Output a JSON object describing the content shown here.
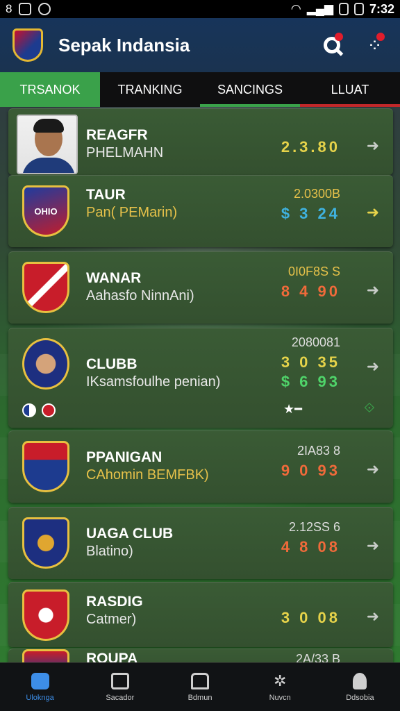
{
  "status_bar": {
    "time": "7:32",
    "left_icons": [
      "8",
      "S",
      "G"
    ]
  },
  "app": {
    "title": "Sepak Indansia"
  },
  "tabs": [
    {
      "label": "TRSANOK",
      "active": true
    },
    {
      "label": "TRANKING",
      "active": false
    },
    {
      "label": "SANCINGS",
      "active": false
    },
    {
      "label": "LLUAT",
      "active": false
    }
  ],
  "entries": [
    {
      "name": "REAGFR",
      "sub": "PHELMAHN",
      "rank": "",
      "score": "2.3.80",
      "score_colors": [
        "#e6d34a"
      ]
    },
    {
      "name": "TAUR",
      "sub": "Pan( PEMarin)",
      "rank": "2.0300B",
      "score": "$ 3 24",
      "score_colors": [
        "#34c77a",
        "#e6d34a",
        "#3fb2e0"
      ]
    },
    {
      "name": "WANAR",
      "sub": "Aahasfo NinnAni)",
      "rank": "0I0F8S S",
      "score": "8 4 90",
      "score_colors": [
        "#f06a3a",
        "#e6d34a",
        "#3fb2e0"
      ]
    },
    {
      "name": "CLUBB",
      "sub": "IKsamsfoulhe penian)",
      "rank": "2080081",
      "score": "3 0 35",
      "score2": "$ 6 93",
      "score_colors": [
        "#e6d34a",
        "#4fd46a",
        "#3fb2e0"
      ],
      "footer_icons": [
        "flag-icon",
        "flag-icon",
        "star-icon",
        "link-icon"
      ]
    },
    {
      "name": "PPANIGAN",
      "sub": "CAhomin BEMFBK)",
      "rank": "2IA83 8",
      "score": "9 0 93",
      "score_colors": [
        "#f06a3a",
        "#3fb2e0",
        "#f06a3a"
      ]
    },
    {
      "name": "UAGA CLUB",
      "sub": "Blatino)",
      "rank": "2.12SS 6",
      "score": "4 8 08",
      "score_colors": [
        "#f06a3a",
        "#f06a3a",
        "#f06a3a"
      ]
    },
    {
      "name": "RASDIG",
      "sub": "Catmer)",
      "rank": "",
      "score": "3 0 08",
      "score_colors": [
        "#e6d34a",
        "#e6d34a",
        "#f06a3a"
      ]
    },
    {
      "name": "ROUPA",
      "sub": "",
      "rank": "2A/33 B",
      "score": "",
      "score_colors": []
    }
  ],
  "bottom_nav": [
    {
      "label": "Uloknga",
      "active": true
    },
    {
      "label": "Sacador",
      "active": false
    },
    {
      "label": "Bdmun",
      "active": false
    },
    {
      "label": "Nuvcn",
      "active": false
    },
    {
      "label": "Ddsobia",
      "active": false
    }
  ],
  "colors": {
    "accent": "#3aa14a",
    "nav_active": "#3d8ee8",
    "card": "#3a5b35"
  }
}
